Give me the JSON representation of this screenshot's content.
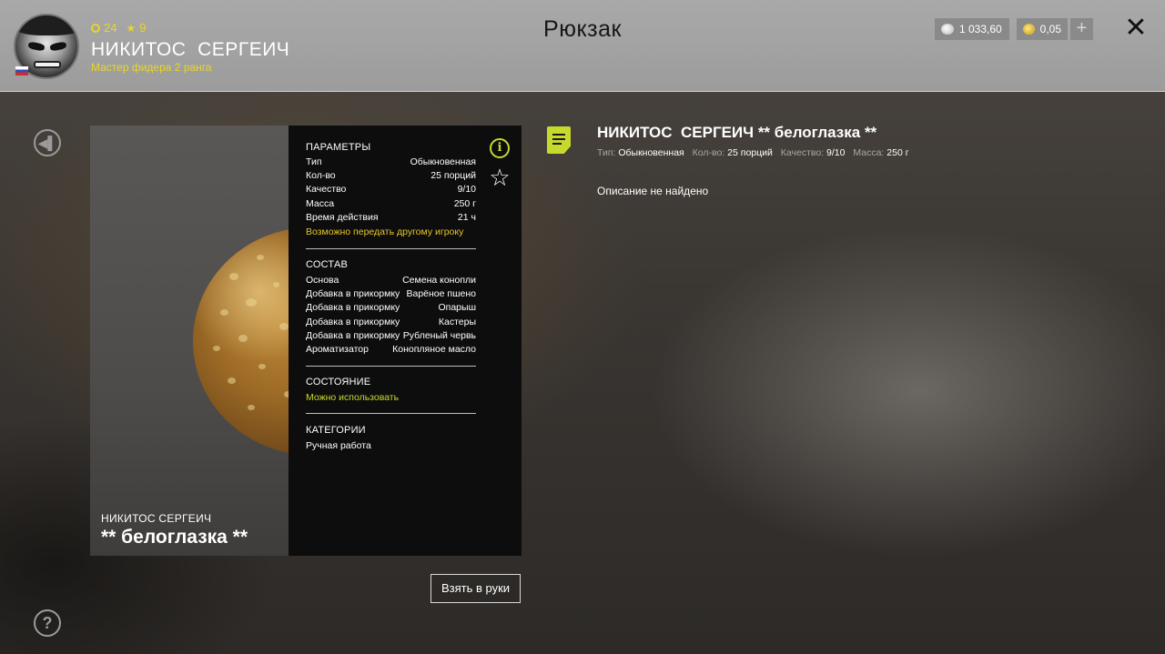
{
  "header": {
    "title": "Рюкзак",
    "player": {
      "name": "НИКИТОС  СЕРГЕИЧ",
      "rank": "Мастер фидера 2 ранга",
      "level": "24",
      "stars": "9"
    },
    "currency": {
      "silver": "1 033,60",
      "gold": "0,05"
    },
    "add_label": "+",
    "close_label": "✕"
  },
  "item": {
    "subtitle": "НИКИТОС СЕРГЕИЧ",
    "name": "** белоглазка **",
    "full_title": "НИКИТОС  СЕРГЕИЧ ** белоглазка **",
    "meta": [
      {
        "label": "Тип:",
        "value": "Обыкновенная"
      },
      {
        "label": "Кол-во:",
        "value": "25 порций"
      },
      {
        "label": "Качество:",
        "value": "9/10"
      },
      {
        "label": "Масса:",
        "value": "250 г"
      }
    ],
    "description": "Описание не найдено",
    "take_button": "Взять в руки"
  },
  "params": {
    "section_params": "ПАРАМЕТРЫ",
    "rows": [
      {
        "key": "Тип",
        "value": "Обыкновенная"
      },
      {
        "key": "Кол-во",
        "value": "25 порций"
      },
      {
        "key": "Качество",
        "value": "9/10"
      },
      {
        "key": "Масса",
        "value": "250 г"
      },
      {
        "key": "Время действия",
        "value": "21 ч"
      }
    ],
    "transfer_note": "Возможно передать другому игроку",
    "section_composition": "СОСТАВ",
    "composition": [
      {
        "key": "Основа",
        "value": "Семена конопли"
      },
      {
        "key": "Добавка в прикормку",
        "value": "Варёное пшено"
      },
      {
        "key": "Добавка в прикормку",
        "value": "Опарыш"
      },
      {
        "key": "Добавка в прикормку",
        "value": "Кастеры"
      },
      {
        "key": "Добавка в прикормку",
        "value": "Рубленый червь"
      },
      {
        "key": "Ароматизатор",
        "value": "Конопляное масло"
      }
    ],
    "section_state": "СОСТОЯНИЕ",
    "state": "Можно использовать",
    "section_categories": "КАТЕГОРИИ",
    "category": "Ручная работа"
  },
  "colors": {
    "accent": "#c8d92e",
    "yellow": "#e8c52a",
    "panel": "#0d0d0d",
    "topbar": "#a3a3a3"
  },
  "icons": {
    "back": "back-arrow-icon",
    "help": "question-icon",
    "info": "info-icon",
    "favorite": "star-outline-icon",
    "doc": "document-icon",
    "silver": "silver-coin-icon",
    "gold": "gold-coin-icon"
  }
}
